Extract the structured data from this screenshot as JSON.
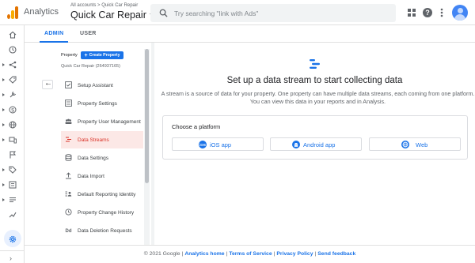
{
  "header": {
    "app_name": "Analytics",
    "breadcrumb": "All accounts > Quick Car Repair",
    "account_name": "Quick Car Repair",
    "search_placeholder": "Try searching \"link with Ads\"",
    "icons": [
      "apps-grid-icon",
      "help-icon",
      "more-vert-icon",
      "account-avatar"
    ]
  },
  "rail": {
    "items": [
      "home-icon",
      "reports-icon",
      "explore-icon",
      "advertising-icon",
      "configure-icon",
      "dollar-icon",
      "globe-icon",
      "devices-icon",
      "flag-icon",
      "tag-icon",
      "library-icon",
      "audience-icon",
      "insights-icon",
      "admin-gear-icon"
    ],
    "active": "admin-gear-icon"
  },
  "tabs": {
    "admin": "ADMIN",
    "user": "USER",
    "active": "ADMIN"
  },
  "property": {
    "label": "Property",
    "create_button": "Create Property",
    "name": "Quick Car Repair (264937165)",
    "menu": [
      {
        "label": "Setup Assistant",
        "icon": "checklist-icon"
      },
      {
        "label": "Property Settings",
        "icon": "settings-square-icon"
      },
      {
        "label": "Property User Management",
        "icon": "people-icon"
      },
      {
        "label": "Data Streams",
        "icon": "streams-icon",
        "selected": true
      },
      {
        "label": "Data Settings",
        "icon": "database-icon"
      },
      {
        "label": "Data Import",
        "icon": "upload-icon"
      },
      {
        "label": "Default Reporting Identity",
        "icon": "identity-icon"
      },
      {
        "label": "Property Change History",
        "icon": "history-icon"
      },
      {
        "label": "Data Deletion Requests",
        "icon": "dd-icon"
      }
    ]
  },
  "main": {
    "title": "Set up a data stream to start collecting data",
    "description": "A stream is a source of data for your property. One property can have multiple data streams, each coming from one platform. You can view this data in your reports and in Analysis.",
    "choose_platform": "Choose a platform",
    "platforms": [
      {
        "label": "iOS app",
        "icon": "ios-icon"
      },
      {
        "label": "Android app",
        "icon": "android-icon"
      },
      {
        "label": "Web",
        "icon": "web-globe-icon"
      }
    ]
  },
  "footer": {
    "copyright": "© 2021 Google",
    "links": [
      "Analytics home",
      "Terms of Service",
      "Privacy Policy",
      "Send feedback"
    ]
  },
  "colors": {
    "accent": "#1a73e8",
    "selected_bg": "#fce8e6",
    "selected_text": "#d93025",
    "logo_orange": "#e37400",
    "logo_yellow": "#f9ab00"
  }
}
